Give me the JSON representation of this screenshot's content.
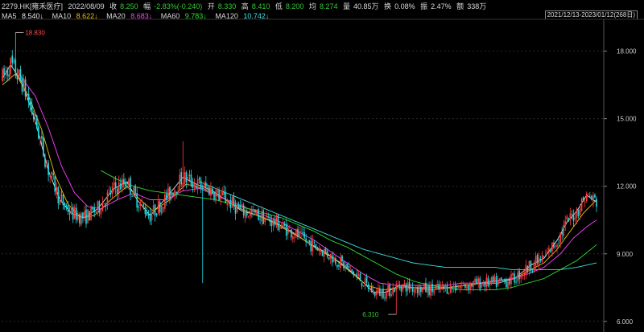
{
  "header": {
    "symbol": "2279.HK[雍禾医疗]",
    "date": "2022/08/09",
    "close_label": "收",
    "close_value": "8.250",
    "change_label": "幅",
    "change_value": "-2.83%(-0.240)",
    "open_label": "开",
    "open_value": "8.330",
    "high_label": "高",
    "high_value": "8.410",
    "low_label": "低",
    "low_value": "8.200",
    "avg_label": "均",
    "avg_value": "8.274",
    "volume_label": "量",
    "volume_value": "40.85万",
    "turnover_label": "换",
    "turnover_value": "0.08%",
    "amplitude_label": "振",
    "amplitude_value": "2.47%",
    "amount_label": "额",
    "amount_value": "338万"
  },
  "ma_bar": [
    {
      "label": "MA5",
      "value": "8.540↓",
      "color": "#e8e8e8"
    },
    {
      "label": "MA10",
      "value": "8.622↓",
      "color": "#f0c000"
    },
    {
      "label": "MA20",
      "value": "8.683↓",
      "color": "#ff40ff"
    },
    {
      "label": "MA60",
      "value": "9.783↓",
      "color": "#30e030"
    },
    {
      "label": "MA120",
      "value": "10.742↓",
      "color": "#40e0e0"
    }
  ],
  "range_label": "2021/12/13-2023/01/12(268日)",
  "chart_data": {
    "type": "candlestick",
    "y_ticks": [
      6.0,
      9.0,
      12.0,
      15.0,
      18.0
    ],
    "y_tick_labels": [
      "6.000",
      "9.000",
      "12.000",
      "15.000",
      "18.000"
    ],
    "ylim": [
      5.85,
      19.2
    ],
    "max_annotation": "18.830",
    "max_value": 18.83,
    "min_annotation": "6.310",
    "min_value": 6.31,
    "up_color": "#ff3c3c",
    "down_color": "#22d8e0",
    "series": [
      {
        "name": "MA5",
        "color": "#e8e8e8",
        "waypoints": [
          [
            0,
            16.8
          ],
          [
            5,
            17.4
          ],
          [
            12,
            16.6
          ],
          [
            20,
            14.9
          ],
          [
            28,
            12.7
          ],
          [
            35,
            11.4
          ],
          [
            42,
            10.8
          ],
          [
            50,
            10.6
          ],
          [
            58,
            11.0
          ],
          [
            68,
            11.9
          ],
          [
            76,
            12.2
          ],
          [
            82,
            11.4
          ],
          [
            90,
            10.7
          ],
          [
            100,
            11.5
          ],
          [
            110,
            12.4
          ],
          [
            118,
            12.1
          ],
          [
            128,
            11.8
          ],
          [
            136,
            11.4
          ],
          [
            146,
            10.9
          ],
          [
            156,
            10.7
          ],
          [
            166,
            10.4
          ],
          [
            176,
            10.0
          ],
          [
            186,
            9.5
          ],
          [
            196,
            9.1
          ],
          [
            206,
            8.6
          ],
          [
            216,
            8.0
          ],
          [
            226,
            7.3
          ],
          [
            234,
            7.3
          ],
          [
            242,
            7.6
          ],
          [
            250,
            7.5
          ],
          [
            262,
            7.4
          ],
          [
            272,
            7.5
          ],
          [
            282,
            7.6
          ],
          [
            292,
            7.7
          ],
          [
            302,
            7.7
          ],
          [
            312,
            7.9
          ],
          [
            322,
            8.5
          ],
          [
            330,
            8.8
          ],
          [
            338,
            9.6
          ],
          [
            344,
            10.4
          ],
          [
            350,
            10.9
          ],
          [
            356,
            11.6
          ],
          [
            362,
            11.3
          ]
        ]
      },
      {
        "name": "MA10",
        "color": "#f0c000",
        "waypoints": [
          [
            0,
            16.5
          ],
          [
            8,
            17.0
          ],
          [
            16,
            16.0
          ],
          [
            24,
            14.5
          ],
          [
            32,
            12.5
          ],
          [
            40,
            11.2
          ],
          [
            48,
            10.6
          ],
          [
            56,
            10.7
          ],
          [
            66,
            11.4
          ],
          [
            76,
            12.0
          ],
          [
            84,
            11.4
          ],
          [
            92,
            10.9
          ],
          [
            102,
            11.4
          ],
          [
            112,
            12.1
          ],
          [
            122,
            11.9
          ],
          [
            132,
            11.6
          ],
          [
            142,
            11.1
          ],
          [
            152,
            10.8
          ],
          [
            162,
            10.5
          ],
          [
            172,
            10.1
          ],
          [
            182,
            9.7
          ],
          [
            192,
            9.2
          ],
          [
            202,
            8.8
          ],
          [
            212,
            8.2
          ],
          [
            222,
            7.6
          ],
          [
            232,
            7.4
          ],
          [
            242,
            7.5
          ],
          [
            252,
            7.5
          ],
          [
            262,
            7.5
          ],
          [
            272,
            7.5
          ],
          [
            282,
            7.6
          ],
          [
            292,
            7.7
          ],
          [
            302,
            7.8
          ],
          [
            312,
            7.9
          ],
          [
            322,
            8.3
          ],
          [
            330,
            8.6
          ],
          [
            338,
            9.2
          ],
          [
            346,
            10.0
          ],
          [
            354,
            10.8
          ],
          [
            362,
            11.4
          ]
        ]
      },
      {
        "name": "MA20",
        "color": "#ff40ff",
        "waypoints": [
          [
            10,
            17.0
          ],
          [
            20,
            16.0
          ],
          [
            28,
            14.6
          ],
          [
            36,
            12.9
          ],
          [
            44,
            11.7
          ],
          [
            52,
            11.1
          ],
          [
            60,
            11.0
          ],
          [
            70,
            11.4
          ],
          [
            80,
            11.7
          ],
          [
            90,
            11.4
          ],
          [
            100,
            11.4
          ],
          [
            110,
            11.8
          ],
          [
            120,
            11.9
          ],
          [
            130,
            11.6
          ],
          [
            140,
            11.3
          ],
          [
            150,
            11.0
          ],
          [
            160,
            10.7
          ],
          [
            170,
            10.4
          ],
          [
            180,
            10.0
          ],
          [
            190,
            9.6
          ],
          [
            200,
            9.1
          ],
          [
            210,
            8.6
          ],
          [
            220,
            8.1
          ],
          [
            230,
            7.7
          ],
          [
            240,
            7.6
          ],
          [
            250,
            7.6
          ],
          [
            260,
            7.6
          ],
          [
            270,
            7.6
          ],
          [
            280,
            7.7
          ],
          [
            290,
            7.7
          ],
          [
            300,
            7.8
          ],
          [
            310,
            7.9
          ],
          [
            320,
            8.1
          ],
          [
            330,
            8.4
          ],
          [
            340,
            9.0
          ],
          [
            348,
            9.7
          ],
          [
            356,
            10.2
          ],
          [
            362,
            10.5
          ]
        ]
      },
      {
        "name": "MA60",
        "color": "#30e030",
        "waypoints": [
          [
            60,
            12.7
          ],
          [
            70,
            12.3
          ],
          [
            80,
            12.0
          ],
          [
            90,
            11.8
          ],
          [
            100,
            11.7
          ],
          [
            110,
            11.6
          ],
          [
            120,
            11.5
          ],
          [
            130,
            11.4
          ],
          [
            140,
            11.2
          ],
          [
            150,
            11.0
          ],
          [
            160,
            10.8
          ],
          [
            170,
            10.6
          ],
          [
            180,
            10.3
          ],
          [
            190,
            10.0
          ],
          [
            200,
            9.6
          ],
          [
            210,
            9.3
          ],
          [
            220,
            8.9
          ],
          [
            230,
            8.5
          ],
          [
            240,
            8.1
          ],
          [
            250,
            7.8
          ],
          [
            260,
            7.6
          ],
          [
            270,
            7.5
          ],
          [
            280,
            7.4
          ],
          [
            290,
            7.4
          ],
          [
            300,
            7.4
          ],
          [
            310,
            7.5
          ],
          [
            320,
            7.7
          ],
          [
            330,
            7.9
          ],
          [
            340,
            8.3
          ],
          [
            350,
            8.7
          ],
          [
            362,
            9.4
          ]
        ]
      },
      {
        "name": "MA120",
        "color": "#40e0e0",
        "waypoints": [
          [
            120,
            12.2
          ],
          [
            130,
            11.9
          ],
          [
            140,
            11.6
          ],
          [
            150,
            11.3
          ],
          [
            160,
            11.0
          ],
          [
            170,
            10.7
          ],
          [
            180,
            10.4
          ],
          [
            190,
            10.1
          ],
          [
            200,
            9.8
          ],
          [
            210,
            9.5
          ],
          [
            220,
            9.2
          ],
          [
            230,
            9.0
          ],
          [
            240,
            8.8
          ],
          [
            250,
            8.6
          ],
          [
            260,
            8.5
          ],
          [
            270,
            8.4
          ],
          [
            280,
            8.4
          ],
          [
            290,
            8.4
          ],
          [
            300,
            8.4
          ],
          [
            310,
            8.3
          ],
          [
            320,
            8.3
          ],
          [
            330,
            8.3
          ],
          [
            340,
            8.3
          ],
          [
            350,
            8.4
          ],
          [
            362,
            8.6
          ]
        ]
      }
    ]
  }
}
